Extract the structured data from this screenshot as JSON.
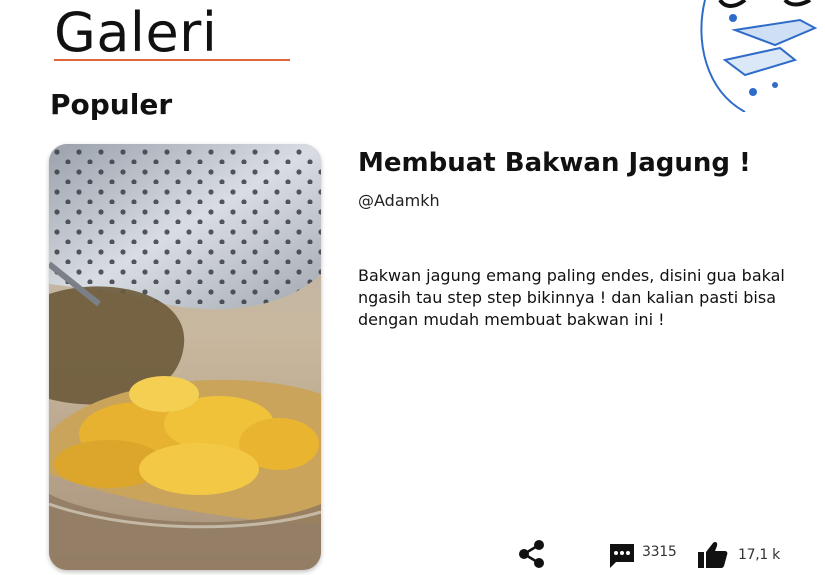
{
  "page": {
    "title": "Galeri",
    "section": "Populer"
  },
  "post": {
    "title": "Membuat Bakwan Jagung !",
    "author": "@Adamkh",
    "description": "Bakwan jagung emang paling endes, disini gua bakal ngasih tau step step bikinnya ! dan kalian pasti bisa dengan mudah membuat bakwan ini !",
    "image": "fried-corn-fritter-photo",
    "comment_count": "3315",
    "like_count": "17,1 k"
  },
  "icons": {
    "share": "share-icon",
    "comment": "comment-icon",
    "like": "thumbs-up-icon"
  },
  "colors": {
    "accent_underline": "#e0643c",
    "deco_orange": "#f2a93b",
    "deco_blue": "#2f6cc9"
  }
}
